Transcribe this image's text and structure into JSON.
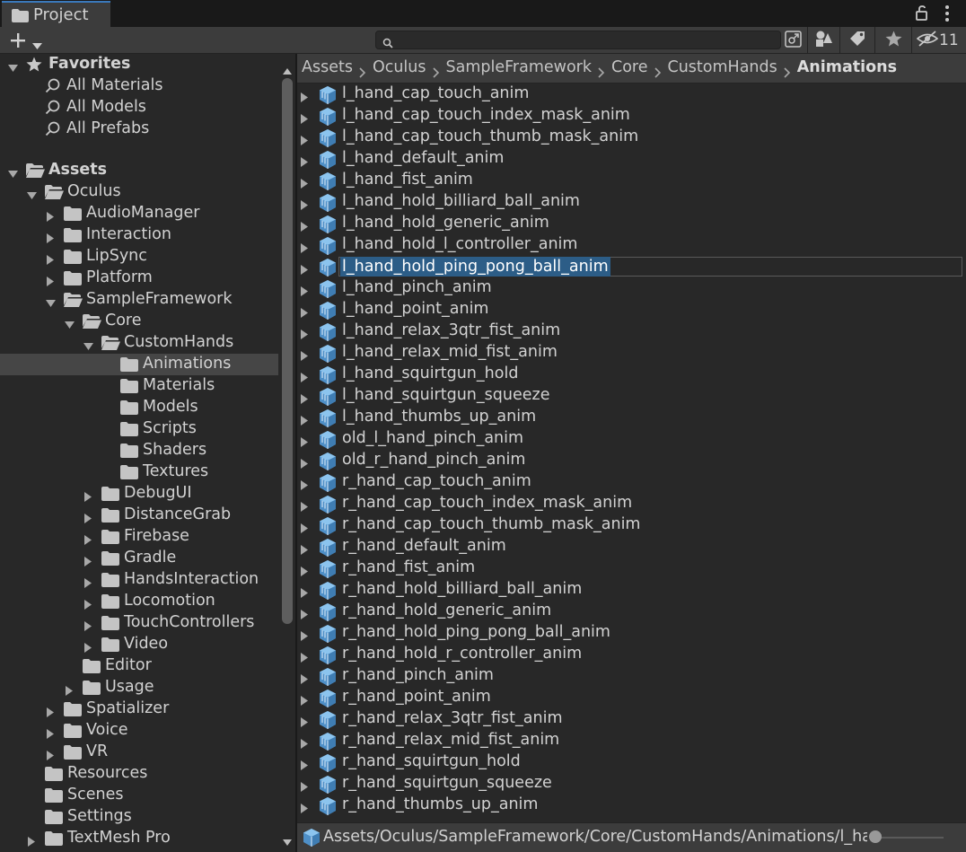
{
  "window": {
    "tab_label": "Project"
  },
  "search": {
    "placeholder": "",
    "value": ""
  },
  "toolbar": {
    "hidden_packages_count": "11"
  },
  "favorites": {
    "label": "Favorites",
    "items": [
      "All Materials",
      "All Models",
      "All Prefabs"
    ]
  },
  "tree": [
    {
      "label": "Assets",
      "depth": 0,
      "arrow": "down",
      "icon": "folder-open",
      "bold": true
    },
    {
      "label": "Oculus",
      "depth": 1,
      "arrow": "down",
      "icon": "folder-open"
    },
    {
      "label": "AudioManager",
      "depth": 2,
      "arrow": "right",
      "icon": "folder"
    },
    {
      "label": "Interaction",
      "depth": 2,
      "arrow": "right",
      "icon": "folder"
    },
    {
      "label": "LipSync",
      "depth": 2,
      "arrow": "right",
      "icon": "folder"
    },
    {
      "label": "Platform",
      "depth": 2,
      "arrow": "right",
      "icon": "folder"
    },
    {
      "label": "SampleFramework",
      "depth": 2,
      "arrow": "down",
      "icon": "folder-open"
    },
    {
      "label": "Core",
      "depth": 3,
      "arrow": "down",
      "icon": "folder-open"
    },
    {
      "label": "CustomHands",
      "depth": 4,
      "arrow": "down",
      "icon": "folder-open"
    },
    {
      "label": "Animations",
      "depth": 5,
      "arrow": "none",
      "icon": "folder",
      "selected": true
    },
    {
      "label": "Materials",
      "depth": 5,
      "arrow": "none",
      "icon": "folder"
    },
    {
      "label": "Models",
      "depth": 5,
      "arrow": "none",
      "icon": "folder"
    },
    {
      "label": "Scripts",
      "depth": 5,
      "arrow": "none",
      "icon": "folder"
    },
    {
      "label": "Shaders",
      "depth": 5,
      "arrow": "none",
      "icon": "folder"
    },
    {
      "label": "Textures",
      "depth": 5,
      "arrow": "none",
      "icon": "folder"
    },
    {
      "label": "DebugUI",
      "depth": 4,
      "arrow": "right",
      "icon": "folder"
    },
    {
      "label": "DistanceGrab",
      "depth": 4,
      "arrow": "right",
      "icon": "folder"
    },
    {
      "label": "Firebase",
      "depth": 4,
      "arrow": "right",
      "icon": "folder"
    },
    {
      "label": "Gradle",
      "depth": 4,
      "arrow": "right",
      "icon": "folder"
    },
    {
      "label": "HandsInteraction",
      "depth": 4,
      "arrow": "right",
      "icon": "folder"
    },
    {
      "label": "Locomotion",
      "depth": 4,
      "arrow": "right",
      "icon": "folder"
    },
    {
      "label": "TouchControllers",
      "depth": 4,
      "arrow": "right",
      "icon": "folder"
    },
    {
      "label": "Video",
      "depth": 4,
      "arrow": "right",
      "icon": "folder"
    },
    {
      "label": "Editor",
      "depth": 3,
      "arrow": "none",
      "icon": "folder"
    },
    {
      "label": "Usage",
      "depth": 3,
      "arrow": "right",
      "icon": "folder"
    },
    {
      "label": "Spatializer",
      "depth": 2,
      "arrow": "right",
      "icon": "folder"
    },
    {
      "label": "Voice",
      "depth": 2,
      "arrow": "right",
      "icon": "folder"
    },
    {
      "label": "VR",
      "depth": 2,
      "arrow": "right",
      "icon": "folder"
    },
    {
      "label": "Resources",
      "depth": 1,
      "arrow": "none",
      "icon": "folder"
    },
    {
      "label": "Scenes",
      "depth": 1,
      "arrow": "none",
      "icon": "folder"
    },
    {
      "label": "Settings",
      "depth": 1,
      "arrow": "none",
      "icon": "folder"
    },
    {
      "label": "TextMesh Pro",
      "depth": 1,
      "arrow": "right",
      "icon": "folder"
    }
  ],
  "breadcrumb": [
    "Assets",
    "Oculus",
    "SampleFramework",
    "Core",
    "CustomHands",
    "Animations"
  ],
  "files": [
    "l_hand_cap_touch_anim",
    "l_hand_cap_touch_index_mask_anim",
    "l_hand_cap_touch_thumb_mask_anim",
    "l_hand_default_anim",
    "l_hand_fist_anim",
    "l_hand_hold_billiard_ball_anim",
    "l_hand_hold_generic_anim",
    "l_hand_hold_l_controller_anim",
    "l_hand_hold_ping_pong_ball_anim",
    "l_hand_pinch_anim",
    "l_hand_point_anim",
    "l_hand_relax_3qtr_fist_anim",
    "l_hand_relax_mid_fist_anim",
    "l_hand_squirtgun_hold",
    "l_hand_squirtgun_squeeze",
    "l_hand_thumbs_up_anim",
    "old_l_hand_pinch_anim",
    "old_r_hand_pinch_anim",
    "r_hand_cap_touch_anim",
    "r_hand_cap_touch_index_mask_anim",
    "r_hand_cap_touch_thumb_mask_anim",
    "r_hand_default_anim",
    "r_hand_fist_anim",
    "r_hand_hold_billiard_ball_anim",
    "r_hand_hold_generic_anim",
    "r_hand_hold_ping_pong_ball_anim",
    "r_hand_hold_r_controller_anim",
    "r_hand_pinch_anim",
    "r_hand_point_anim",
    "r_hand_relax_3qtr_fist_anim",
    "r_hand_relax_mid_fist_anim",
    "r_hand_squirtgun_hold",
    "r_hand_squirtgun_squeeze",
    "r_hand_thumbs_up_anim"
  ],
  "selected_file": "l_hand_hold_ping_pong_ball_anim",
  "status": {
    "path": "Assets/Oculus/SampleFramework/Core/CustomHands/Animations/l_hand_hold_ping_pong_ball_anim.fbx"
  },
  "colors": {
    "selection": "#2c5d87",
    "accent_tab": "#3a79bb",
    "asset_icon": "#63a7d8"
  }
}
